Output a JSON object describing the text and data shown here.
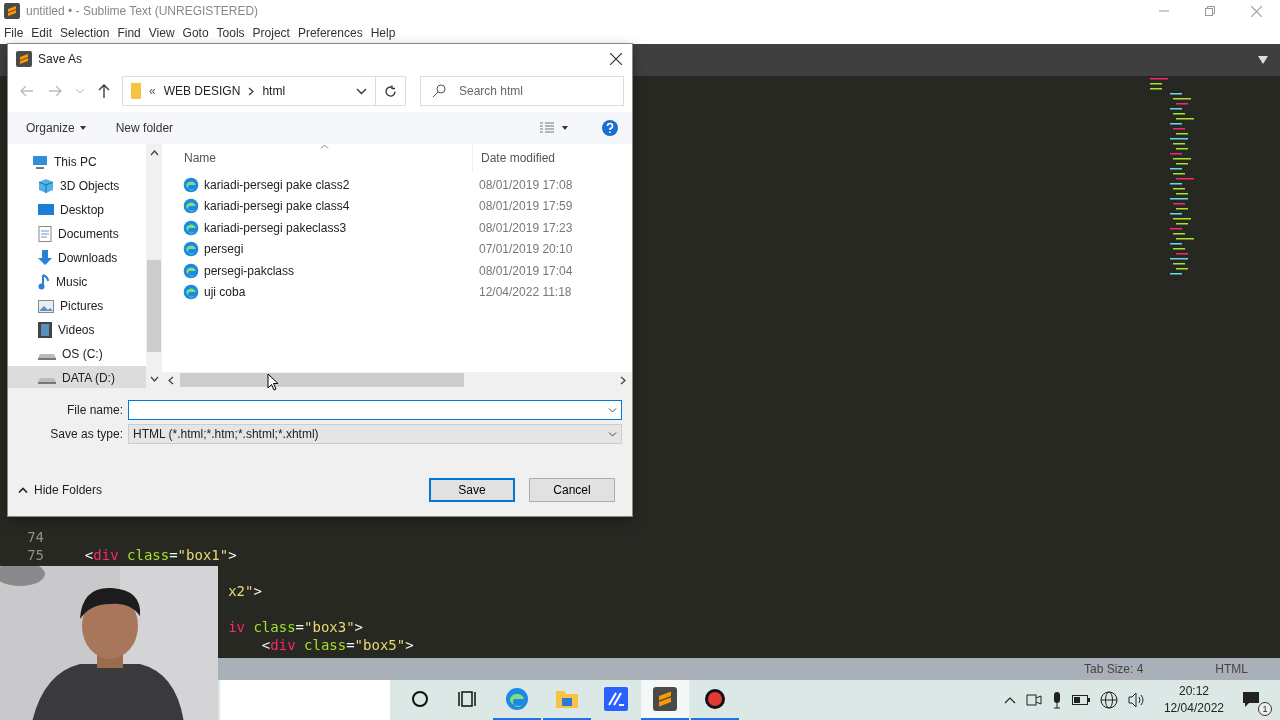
{
  "window": {
    "title": "untitled • - Sublime Text (UNREGISTERED)"
  },
  "menu": [
    "File",
    "Edit",
    "Selection",
    "Find",
    "View",
    "Goto",
    "Tools",
    "Project",
    "Preferences",
    "Help"
  ],
  "editor": {
    "code_lines": [
      {
        "number": "74",
        "kind": "blank"
      },
      {
        "number": "75",
        "kind": "code",
        "tokens": [
          {
            "kind": "punct",
            "text": "  <"
          },
          {
            "kind": "tag",
            "text": "div"
          },
          {
            "kind": "attr",
            "text": " class"
          },
          {
            "kind": "punct",
            "text": "="
          },
          {
            "kind": "string",
            "text": "\"box1\""
          },
          {
            "kind": "punct",
            "text": ">"
          }
        ]
      },
      {
        "kind": "blank"
      },
      {
        "kind": "code",
        "tokens": [
          {
            "kind": "string",
            "text": "                   x2\""
          },
          {
            "kind": "punct",
            "text": ">"
          }
        ]
      },
      {
        "kind": "blank"
      },
      {
        "kind": "code",
        "tokens": [
          {
            "kind": "tag",
            "text": "                   iv"
          },
          {
            "kind": "attr",
            "text": " class"
          },
          {
            "kind": "punct",
            "text": "="
          },
          {
            "kind": "string",
            "text": "\"box3\""
          },
          {
            "kind": "punct",
            "text": ">"
          }
        ]
      },
      {
        "kind": "code",
        "tokens": [
          {
            "kind": "punct",
            "text": "                       <"
          },
          {
            "kind": "tag",
            "text": "div"
          },
          {
            "kind": "attr",
            "text": " class"
          },
          {
            "kind": "punct",
            "text": "="
          },
          {
            "kind": "string",
            "text": "\"box5\""
          },
          {
            "kind": "punct",
            "text": ">"
          }
        ]
      }
    ]
  },
  "status_bar": {
    "tab_size": "Tab Size: 4",
    "syntax": "HTML"
  },
  "dialog": {
    "title": "Save As",
    "address": {
      "overflow": "«",
      "path": [
        "WEB DESIGN",
        "html"
      ]
    },
    "search": {
      "placeholder": "Search html"
    },
    "toolbar": {
      "organize": "Organize",
      "new_folder": "New folder"
    },
    "nav_pane": [
      {
        "label": "This PC",
        "kind": "pc",
        "selected": false
      },
      {
        "label": "3D Objects",
        "kind": "objects",
        "selected": false
      },
      {
        "label": "Desktop",
        "kind": "desktop",
        "selected": false
      },
      {
        "label": "Documents",
        "kind": "documents",
        "selected": false
      },
      {
        "label": "Downloads",
        "kind": "downloads",
        "selected": false
      },
      {
        "label": "Music",
        "kind": "music",
        "selected": false
      },
      {
        "label": "Pictures",
        "kind": "pictures",
        "selected": false
      },
      {
        "label": "Videos",
        "kind": "videos",
        "selected": false
      },
      {
        "label": "OS (C:)",
        "kind": "drive",
        "selected": false
      },
      {
        "label": "DATA (D:)",
        "kind": "drive",
        "selected": true
      }
    ],
    "columns": [
      "Name",
      "Date modified"
    ],
    "files": [
      {
        "name": "kariadi-persegi pake class2",
        "date": "08/01/2019 17:08"
      },
      {
        "name": "kariadi-persegi pake class4",
        "date": "08/01/2019 17:59"
      },
      {
        "name": "kariadi-persegi pakeclass3",
        "date": "08/01/2019 17:23"
      },
      {
        "name": "persegi",
        "date": "07/01/2019 20:10"
      },
      {
        "name": "persegi-pakclass",
        "date": "08/01/2019 17:04"
      },
      {
        "name": "uji coba",
        "date": "12/04/2022 11:18"
      }
    ],
    "file_name": {
      "label": "File name:"
    },
    "save_as_type": {
      "label": "Save as type:",
      "value": "HTML (*.html;*.htm;*.shtml;*.xhtml)"
    },
    "hide_folders": "Hide Folders",
    "buttons": [
      {
        "label": "Save",
        "default": true
      },
      {
        "label": "Cancel",
        "default": false
      }
    ]
  },
  "taskbar": {
    "apps": [
      {
        "kind": "cortana",
        "running": false,
        "active": false
      },
      {
        "kind": "taskview",
        "running": false,
        "active": false
      },
      {
        "kind": "edge",
        "running": true,
        "active": false
      },
      {
        "kind": "explorer",
        "running": true,
        "active": false
      },
      {
        "kind": "editor",
        "running": false,
        "active": false
      },
      {
        "kind": "sublime",
        "running": true,
        "active": true
      },
      {
        "kind": "record",
        "running": true,
        "active": false
      }
    ],
    "time": "20:12",
    "date": "12/04/2022",
    "notifications": "1"
  }
}
